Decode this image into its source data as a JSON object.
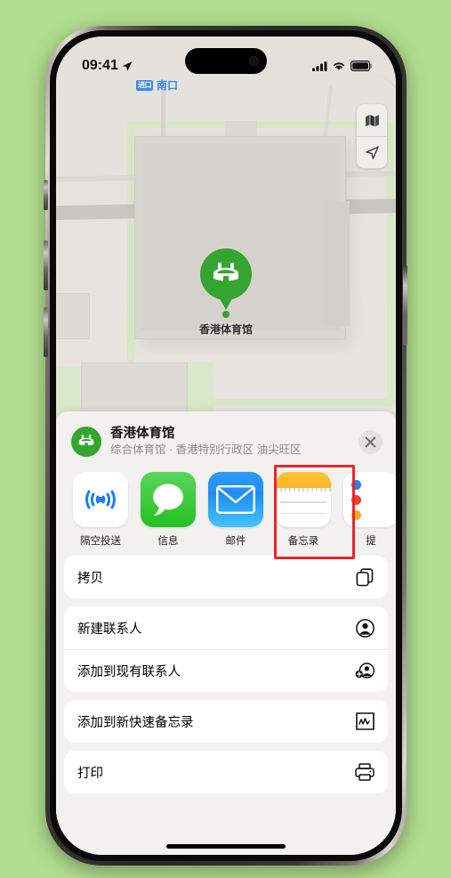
{
  "statusbar": {
    "time": "09:41",
    "location_icon": "location-arrow-icon",
    "cellular_icon": "cellular-bars-icon",
    "wifi_icon": "wifi-icon",
    "battery_icon": "battery-icon"
  },
  "map": {
    "transit_badge": "进口",
    "transit_label": "南口",
    "pin_label": "香港体育馆",
    "controls": [
      {
        "name": "map-layers-button",
        "icon": "map-icon"
      },
      {
        "name": "user-location-button",
        "icon": "location-arrow-icon"
      }
    ]
  },
  "share_sheet": {
    "place_title": "香港体育馆",
    "place_subtitle": "综合体育馆 · 香港特别行政区 油尖旺区",
    "place_icon": "stadium-icon",
    "close_label": "✕",
    "apps": [
      {
        "label": "隔空投送",
        "icon": "airdrop-icon"
      },
      {
        "label": "信息",
        "icon": "messages-icon"
      },
      {
        "label": "邮件",
        "icon": "mail-icon"
      },
      {
        "label": "备忘录",
        "icon": "notes-icon",
        "highlighted": true
      },
      {
        "label": "提",
        "icon": "reminders-icon"
      }
    ],
    "actions_group_1": [
      {
        "label": "拷贝",
        "icon": "doc-on-doc-icon"
      }
    ],
    "actions_group_2": [
      {
        "label": "新建联系人",
        "icon": "person-circle-icon"
      },
      {
        "label": "添加到现有联系人",
        "icon": "person-badge-plus-icon"
      }
    ],
    "actions_group_3": [
      {
        "label": "添加到新快速备忘录",
        "icon": "quick-note-icon"
      }
    ],
    "actions_group_4": [
      {
        "label": "打印",
        "icon": "printer-icon"
      }
    ]
  },
  "colors": {
    "background": "#b2dd8e",
    "accent_green": "#34a531",
    "highlight_red": "#e8262a",
    "transit_blue": "#3b8aed"
  }
}
